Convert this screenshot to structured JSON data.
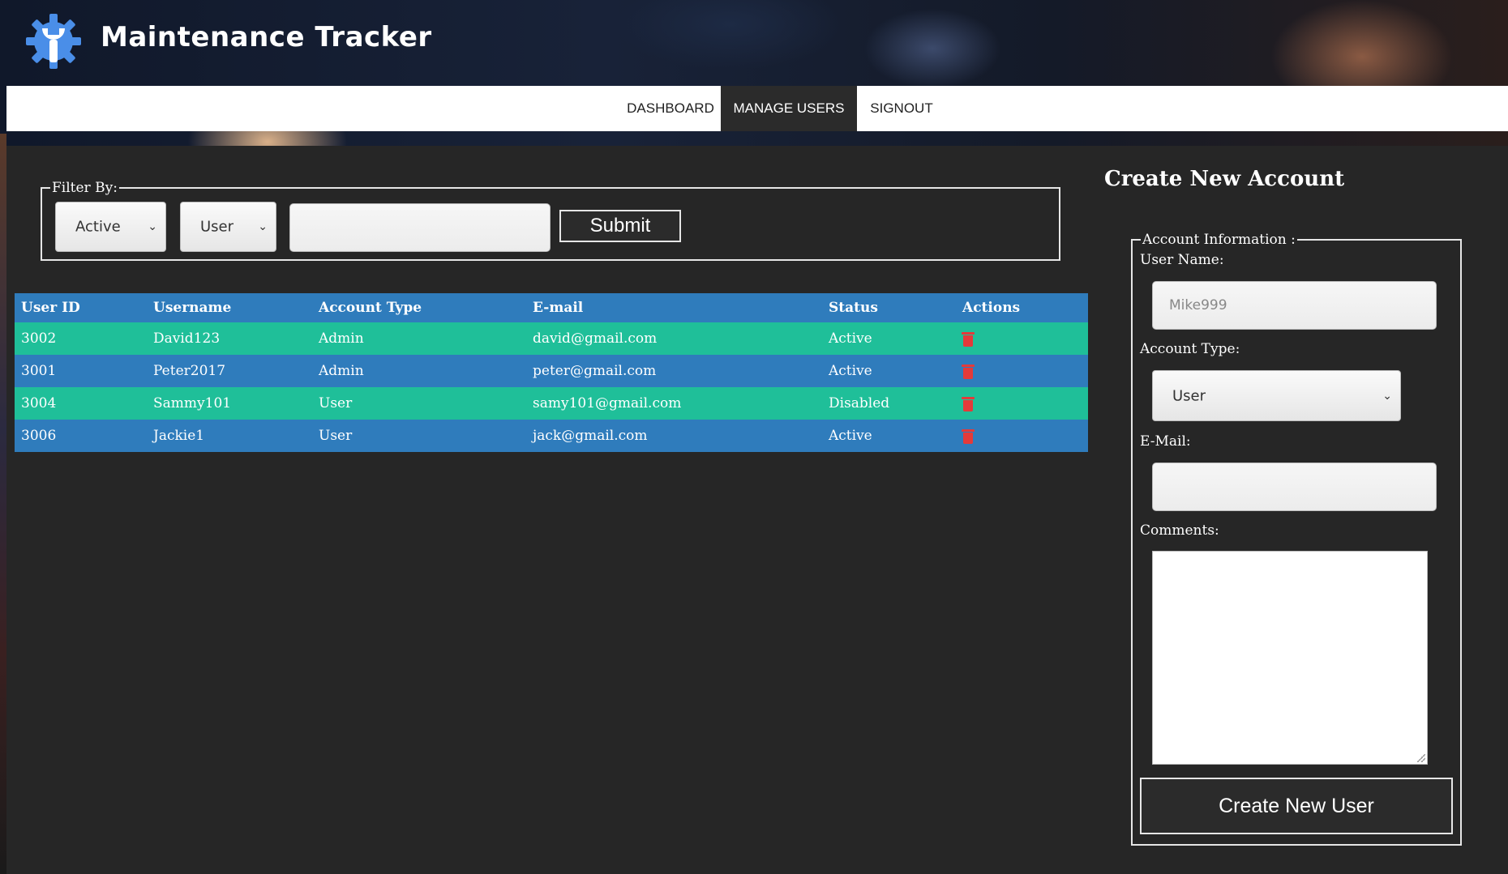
{
  "header": {
    "title": "Maintenance Tracker",
    "logo": "gear-wrench-icon"
  },
  "nav": {
    "items": [
      {
        "label": "DASHBOARD",
        "active": false
      },
      {
        "label": "MANAGE USERS",
        "active": true
      },
      {
        "label": "SIGNOUT",
        "active": false
      }
    ]
  },
  "filter": {
    "legend": "Filter By:",
    "status_value": "Active",
    "type_value": "User",
    "search_value": "",
    "submit_label": "Submit"
  },
  "table": {
    "columns": [
      "User ID",
      "Username",
      "Account Type",
      "E-mail",
      "Status",
      "Actions"
    ],
    "rows": [
      [
        "3002",
        "David123",
        "Admin",
        "david@gmail.com",
        "Active"
      ],
      [
        "3001",
        "Peter2017",
        "Admin",
        "peter@gmail.com",
        "Active"
      ],
      [
        "3004",
        "Sammy101",
        "User",
        "samy101@gmail.com",
        "Disabled"
      ],
      [
        "3006",
        "Jackie1",
        "User",
        "jack@gmail.com",
        "Active"
      ]
    ],
    "action_icon": "trash-icon",
    "row_colors": [
      "#1fbf99",
      "#2f7cbc"
    ],
    "header_color": "#2f7cbc"
  },
  "create": {
    "title": "Create New Account",
    "legend": "Account Information :",
    "username_label": "User Name:",
    "username_placeholder": "Mike999",
    "account_type_label": "Account Type:",
    "account_type_value": "User",
    "email_label": "E-Mail:",
    "comments_label": "Comments:",
    "button_label": "Create New User"
  }
}
